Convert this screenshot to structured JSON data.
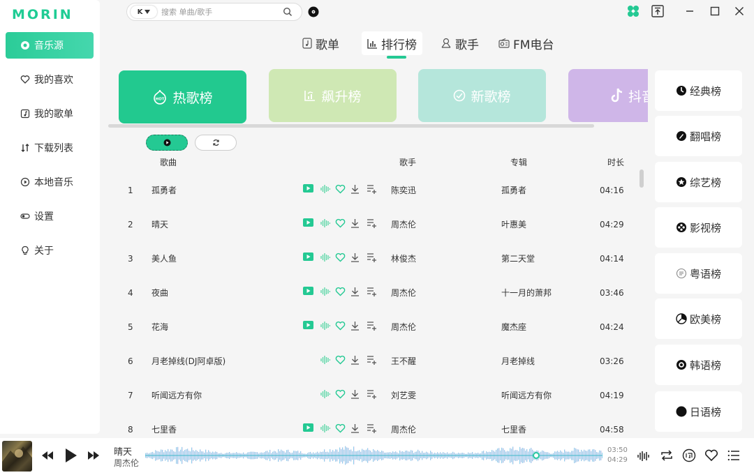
{
  "app": {
    "logo": "MORIN",
    "colors": {
      "accent": "#24c993",
      "hot": "#22c98f",
      "rising": "#cfe8b4",
      "new": "#b5e6db",
      "douyin": "#cfb6e8"
    }
  },
  "sidebar": {
    "items": [
      {
        "label": "音乐源",
        "icon": "music-source-icon",
        "active": true
      },
      {
        "label": "我的喜欢",
        "icon": "heart-icon"
      },
      {
        "label": "我的歌单",
        "icon": "playlist-icon"
      },
      {
        "label": "下载列表",
        "icon": "download-list-icon"
      },
      {
        "label": "本地音乐",
        "icon": "local-music-icon"
      },
      {
        "label": "设置",
        "icon": "settings-icon"
      },
      {
        "label": "关于",
        "icon": "bulb-icon"
      }
    ]
  },
  "search": {
    "source": "K",
    "placeholder": "搜索 单曲/歌手"
  },
  "tabs": [
    {
      "label": "歌单",
      "icon": "playlist-tab-icon"
    },
    {
      "label": "排行榜",
      "icon": "chart-tab-icon",
      "active": true
    },
    {
      "label": "歌手",
      "icon": "singer-tab-icon"
    },
    {
      "label": "FM电台",
      "icon": "radio-tab-icon"
    }
  ],
  "cards": [
    {
      "label": "热歌榜",
      "icon": "hot-icon"
    },
    {
      "label": "飙升榜",
      "icon": "rising-icon"
    },
    {
      "label": "新歌榜",
      "icon": "new-icon"
    },
    {
      "label": "抖音",
      "icon": "douyin-icon"
    }
  ],
  "table": {
    "headers": {
      "song": "歌曲",
      "artist": "歌手",
      "album": "专辑",
      "duration": "时长"
    },
    "rows": [
      {
        "index": "1",
        "title": "孤勇者",
        "mv": true,
        "artist": "陈奕迅",
        "album": "孤勇者",
        "duration": "04:16"
      },
      {
        "index": "2",
        "title": "晴天",
        "mv": true,
        "artist": "周杰伦",
        "album": "叶惠美",
        "duration": "04:29"
      },
      {
        "index": "3",
        "title": "美人鱼",
        "mv": true,
        "artist": "林俊杰",
        "album": "第二天堂",
        "duration": "04:14"
      },
      {
        "index": "4",
        "title": "夜曲",
        "mv": true,
        "artist": "周杰伦",
        "album": "十一月的萧邦",
        "duration": "03:46"
      },
      {
        "index": "5",
        "title": "花海",
        "mv": true,
        "artist": "周杰伦",
        "album": "魔杰座",
        "duration": "04:24"
      },
      {
        "index": "6",
        "title": "月老掉线(DJ阿卓版)",
        "mv": false,
        "artist": "王不醒",
        "album": "月老掉线",
        "duration": "03:26"
      },
      {
        "index": "7",
        "title": "听闻远方有你",
        "mv": false,
        "artist": "刘艺雯",
        "album": "听闻远方有你",
        "duration": "04:19"
      },
      {
        "index": "8",
        "title": "七里香",
        "mv": true,
        "artist": "周杰伦",
        "album": "七里香",
        "duration": "04:58"
      }
    ]
  },
  "rank_list": [
    {
      "label": "经典榜",
      "icon": "classic-icon"
    },
    {
      "label": "翻唱榜",
      "icon": "cover-icon"
    },
    {
      "label": "综艺榜",
      "icon": "variety-icon"
    },
    {
      "label": "影视榜",
      "icon": "film-icon"
    },
    {
      "label": "粤语榜",
      "icon": "cantonese-icon"
    },
    {
      "label": "欧美榜",
      "icon": "western-icon"
    },
    {
      "label": "韩语榜",
      "icon": "korean-icon"
    },
    {
      "label": "日语榜",
      "icon": "japanese-icon"
    }
  ],
  "player": {
    "title": "晴天",
    "artist": "周杰伦",
    "elapsed": "03:50",
    "total": "04:29",
    "progress": 0.855
  }
}
